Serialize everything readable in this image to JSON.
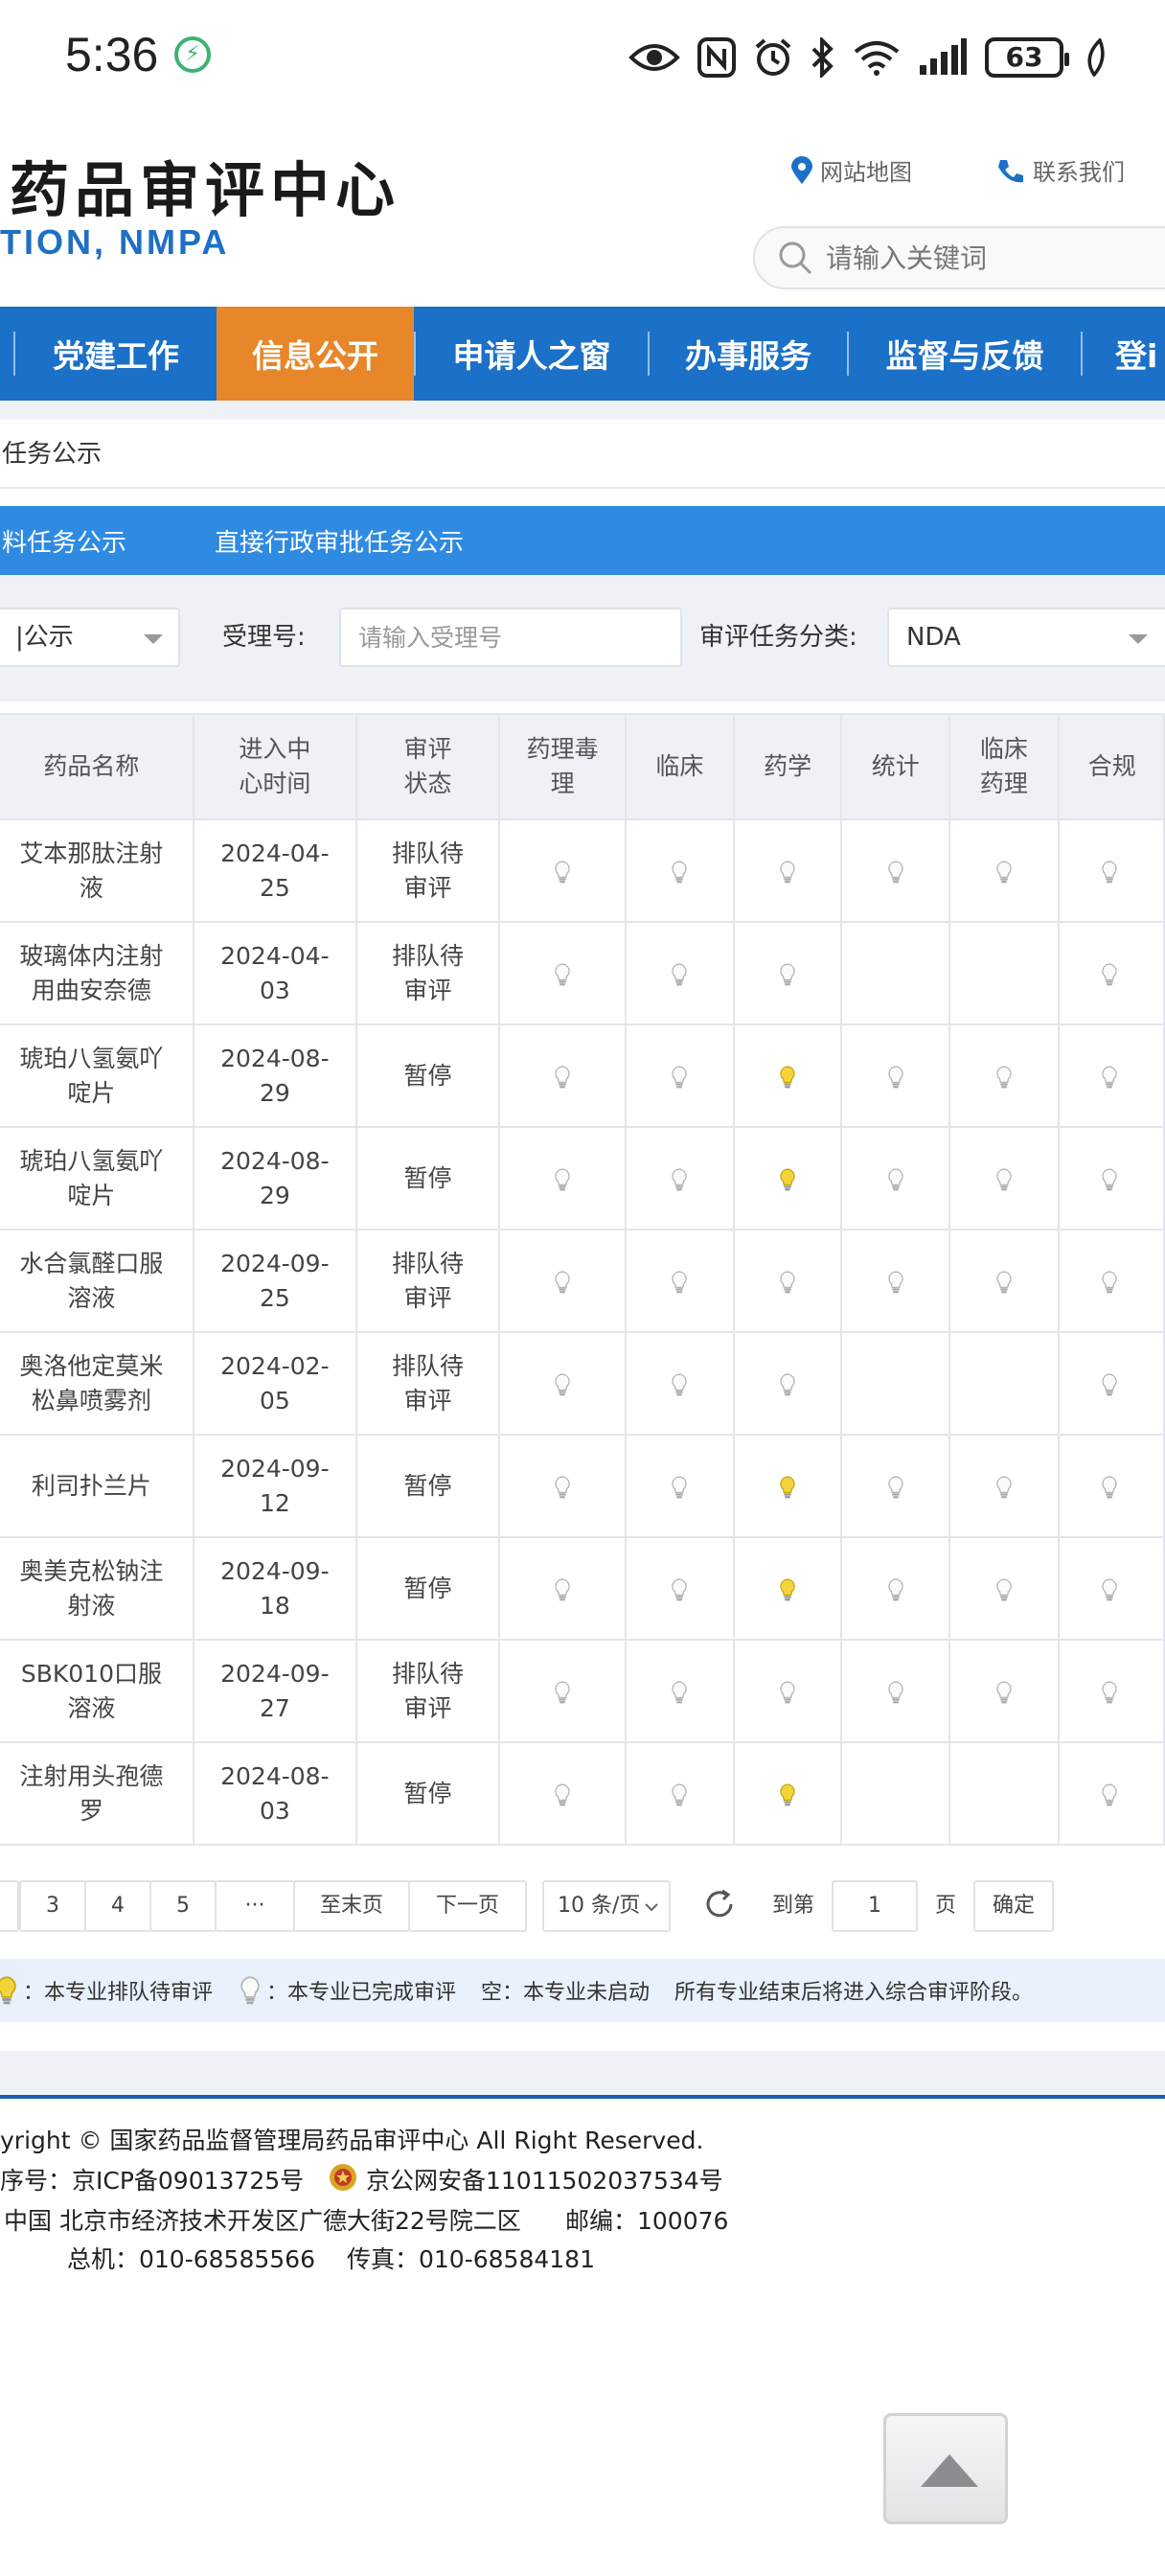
{
  "status_bar": {
    "time": "5:36",
    "battery": "63",
    "icons": [
      "app-icon",
      "eye-icon",
      "nfc-icon",
      "alarm-icon",
      "bluetooth-icon",
      "wifi-icon",
      "signal-icon",
      "battery-icon",
      "leaf-icon"
    ]
  },
  "header": {
    "title": "药品审评中心",
    "subtitle": "TION, NMPA",
    "site_map": "网站地图",
    "contact": "联系我们",
    "search_placeholder": "请输入关键词"
  },
  "nav": {
    "items": [
      {
        "label": "党建工作",
        "active": false
      },
      {
        "label": "信息公开",
        "active": true
      },
      {
        "label": "申请人之窗",
        "active": false
      },
      {
        "label": "办事服务",
        "active": false
      },
      {
        "label": "监督与反馈",
        "active": false
      },
      {
        "label": "登i",
        "active": false
      }
    ],
    "colors": {
      "bar": "#1b70c7",
      "active": "#e8862a"
    }
  },
  "breadcrumb": "任务公示",
  "subtabs": [
    "料任务公示",
    "直接行政审批任务公示"
  ],
  "filter": {
    "status_select": "|公示",
    "accept_label": "受理号:",
    "accept_placeholder": "请输入受理号",
    "category_label": "审评任务分类:",
    "category_value": "NDA"
  },
  "table": {
    "headers": [
      "药品名称",
      "进入中心时间",
      "审评状态",
      "药理毒理",
      "临床",
      "药学",
      "统计",
      "临床药理",
      "合规"
    ],
    "rows": [
      {
        "name": "艾本那肽注射液",
        "date": "2024-04-25",
        "status": "排队待审评",
        "bulbs": [
          "done",
          "done",
          "done",
          "done",
          "done",
          "done"
        ]
      },
      {
        "name": "玻璃体内注射用曲安奈德",
        "date": "2024-04-03",
        "status": "排队待审评",
        "bulbs": [
          "done",
          "done",
          "done",
          "none",
          "none",
          "done"
        ]
      },
      {
        "name": "琥珀八氢氨吖啶片",
        "date": "2024-08-29",
        "status": "暂停",
        "bulbs": [
          "done",
          "done",
          "queue",
          "done",
          "done",
          "done"
        ]
      },
      {
        "name": "琥珀八氢氨吖啶片",
        "date": "2024-08-29",
        "status": "暂停",
        "bulbs": [
          "done",
          "done",
          "queue",
          "done",
          "done",
          "done"
        ]
      },
      {
        "name": "水合氯醛口服溶液",
        "date": "2024-09-25",
        "status": "排队待审评",
        "bulbs": [
          "done",
          "done",
          "done",
          "done",
          "done",
          "done"
        ]
      },
      {
        "name": "奥洛他定莫米松鼻喷雾剂",
        "date": "2024-02-05",
        "status": "排队待审评",
        "bulbs": [
          "done",
          "done",
          "done",
          "none",
          "none",
          "done"
        ]
      },
      {
        "name": "利司扑兰片",
        "date": "2024-09-12",
        "status": "暂停",
        "bulbs": [
          "done",
          "done",
          "queue",
          "done",
          "done",
          "done"
        ]
      },
      {
        "name": "奥美克松钠注射液",
        "date": "2024-09-18",
        "status": "暂停",
        "bulbs": [
          "done",
          "done",
          "queue",
          "done",
          "done",
          "done"
        ]
      },
      {
        "name": "SBK010口服溶液",
        "date": "2024-09-27",
        "status": "排队待审评",
        "bulbs": [
          "done",
          "done",
          "done",
          "done",
          "done",
          "done"
        ]
      },
      {
        "name": "注射用头孢德罗",
        "date": "2024-08-03",
        "status": "暂停",
        "bulbs": [
          "done",
          "done",
          "queue",
          "none",
          "none",
          "done"
        ]
      }
    ]
  },
  "pager": {
    "pages": [
      "3",
      "4",
      "5",
      "···"
    ],
    "last": "至末页",
    "next": "下一页",
    "page_size": "10 条/页",
    "goto_label": "到第",
    "goto_value": "1",
    "page_unit": "页",
    "confirm": "确定"
  },
  "legend": {
    "queue": "：本专业排队待审评",
    "done": "：本专业已完成审评",
    "empty": "空：本专业未启动",
    "note": "所有专业结束后将进入综合审评阶段。"
  },
  "footer": {
    "copyright": "yright © 国家药品监督管理局药品审评中心   All Right Reserved.",
    "icp": "序号：京ICP备09013725号",
    "police": "京公网安备11011502037534号",
    "address": "中国 北京市经济技术开发区广德大街22号院二区",
    "postcode": "邮编：100076",
    "phone": "总机：010-68585566",
    "fax": "传真：010-68584181"
  }
}
